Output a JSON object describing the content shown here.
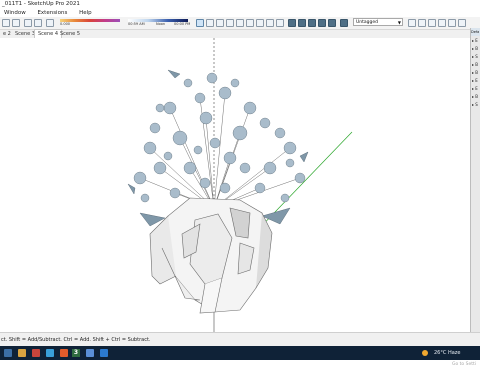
{
  "window": {
    "title": "_011T1 - SketchUp Pro 2021"
  },
  "menu": {
    "items": [
      "Window",
      "Extensions",
      "Help"
    ]
  },
  "toolbar": {
    "scale_left": "0.000",
    "scale_mid": "00:59 AM",
    "scale_noon": "Noon",
    "scale_right": "00:00 PM",
    "layer_select": "Untagged"
  },
  "scene_tabs": [
    "e 2",
    "Scene 3",
    "Scene 4",
    "Scene 5"
  ],
  "active_tab_index": 2,
  "tray": {
    "header": "Defa",
    "items": [
      "▸ E",
      "▸ B",
      "▸ S",
      "▸ B",
      "▸ B",
      "▸ E",
      "▸ E",
      "▸ B",
      "▸ S"
    ]
  },
  "status": {
    "text": "ct.  Shift = Add/Subtract.  Ctrl = Add.  Shift + Ctrl = Subtract."
  },
  "watermark": {
    "line1": "Activate W",
    "line2": "Go to Setti"
  },
  "taskbar": {
    "weather": "26°C  Haze",
    "app_badge": "3"
  },
  "colors": {
    "green_axis": "#2aa62a",
    "red_axis": "#c0392b",
    "blue_axis": "#2c3e9e",
    "taskbar": "#0f2237"
  }
}
